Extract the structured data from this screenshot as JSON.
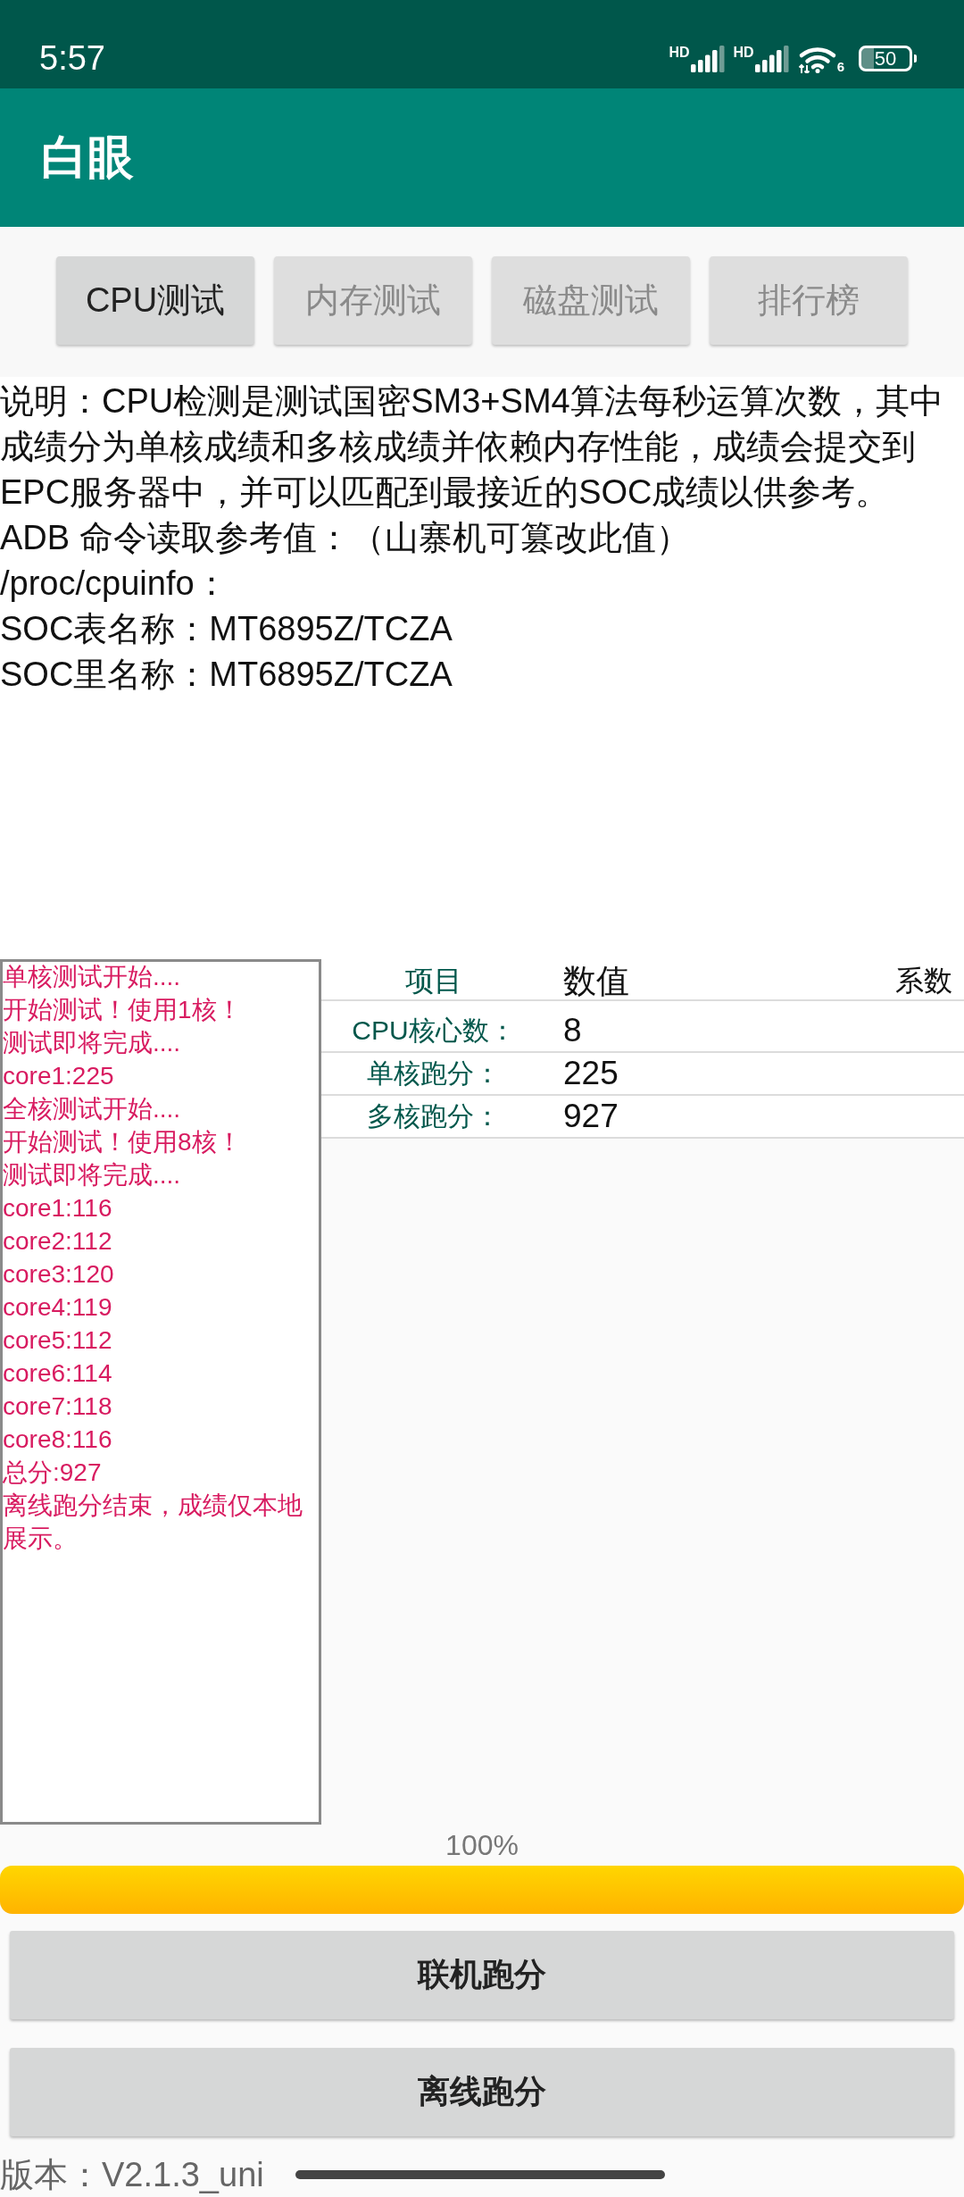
{
  "status_bar": {
    "time": "5:57",
    "signals": [
      {
        "label": "HD"
      },
      {
        "label": "HD"
      }
    ],
    "wifi_label": "6",
    "battery": "50"
  },
  "app_bar": {
    "title": "白眼"
  },
  "tabs": [
    {
      "label": "CPU测试",
      "selected": true
    },
    {
      "label": "内存测试",
      "selected": false
    },
    {
      "label": "磁盘测试",
      "selected": false
    },
    {
      "label": "排行榜",
      "selected": false
    }
  ],
  "description": {
    "text": "说明：CPU检测是测试国密SM3+SM4算法每秒运算次数，其中成绩分为单核成绩和多核成绩并依赖内存性能，成绩会提交到EPC服务器中，并可以匹配到最接近的SOC成绩以供参考。",
    "lines": [
      "ADB 命令读取参考值：（山寨机可篡改此值）",
      "/proc/cpuinfo：",
      "SOC表名称：MT6895Z/TCZA",
      "SOC里名称：MT6895Z/TCZA"
    ]
  },
  "log": {
    "lines": [
      "单核测试开始....",
      "开始测试！使用1核！",
      "测试即将完成....",
      "core1:225",
      "全核测试开始....",
      "开始测试！使用8核！",
      "测试即将完成....",
      "core1:116",
      "core2:112",
      "core3:120",
      "core4:119",
      "core5:112",
      "core6:114",
      "core7:118",
      "core8:116",
      "总分:927",
      "离线跑分结束，成绩仅本地展示。"
    ]
  },
  "table": {
    "columns": [
      "项目",
      "数值",
      "系数"
    ],
    "rows": [
      {
        "label": "CPU核心数：",
        "value": "8"
      },
      {
        "label": "单核跑分：",
        "value": "225"
      },
      {
        "label": "多核跑分：",
        "value": "927"
      }
    ]
  },
  "progress": {
    "label": "100%",
    "level": 1.0
  },
  "buttons": [
    "联机跑分",
    "离线跑分"
  ],
  "footer": {
    "version": "版本：V2.1.3_uni"
  }
}
